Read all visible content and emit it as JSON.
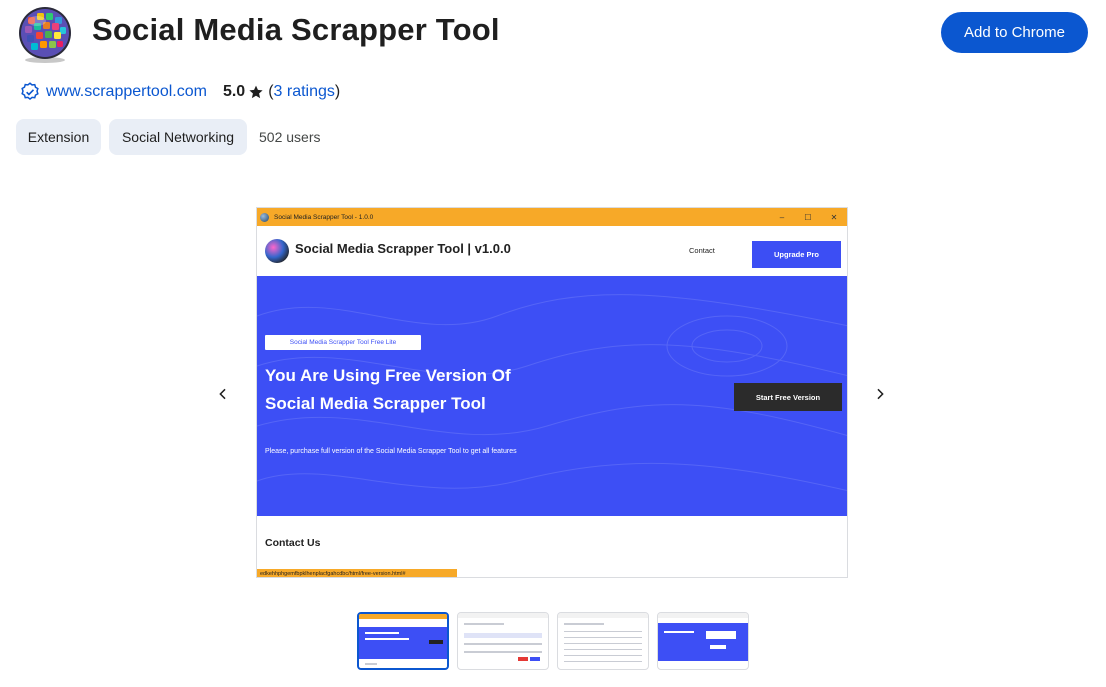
{
  "header": {
    "title": "Social Media Scrapper Tool",
    "add_button": "Add to Chrome"
  },
  "meta": {
    "website": "www.scrappertool.com",
    "rating": "5.0",
    "ratings_open": "(",
    "ratings_link": "3 ratings",
    "ratings_close": ")"
  },
  "chips": {
    "type": "Extension",
    "category": "Social Networking"
  },
  "users": "502 users",
  "screenshot": {
    "window_title": "Social Media Scrapper Tool - 1.0.0",
    "brand": "Social Media Scrapper Tool | v1.0.0",
    "contact_link": "Contact",
    "upgrade_button": "Upgrade Pro",
    "pill": "Social Media Scrapper Tool Free Lite",
    "heading_line1": "You Are Using Free Version Of",
    "heading_line2": "Social Media Scrapper Tool",
    "start_button": "Start Free Version",
    "description": "Please, purchase full version of the Social Media Scrapper Tool to get all features",
    "contact_us": "Contact Us",
    "url": "edkehhphgemfbpklhenplacfgahcdbc/html/free-version.html#",
    "window_controls": [
      "–",
      "☐",
      "✕"
    ]
  },
  "icons": {
    "prev": "chevron-left-icon",
    "next": "chevron-right-icon",
    "verified": "verified-badge-icon",
    "star": "star-icon"
  },
  "colors": {
    "accent": "#0b57d0",
    "chip_bg": "#e9eef6",
    "hero_blue": "#3d4ff5",
    "titlebar_orange": "#f7a928"
  },
  "thumbnails": {
    "count": 4,
    "active_index": 0
  }
}
